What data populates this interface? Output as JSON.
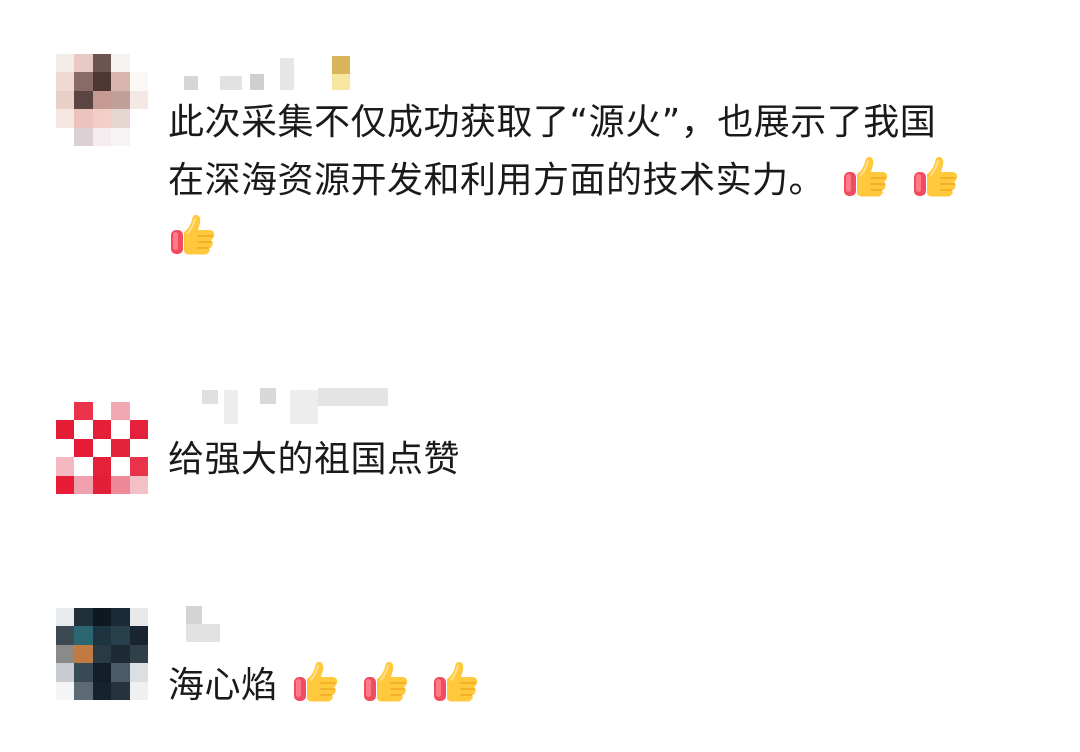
{
  "comments": [
    {
      "lines": [
        "此次采集不仅成功获取了“源火”，也展示了我国",
        "在深海资源开发和利用方面的技术实力。"
      ],
      "emojis": [
        "thumbs-up",
        "thumbs-up",
        "thumbs-up"
      ]
    },
    {
      "lines": [
        "给强大的祖国点赞"
      ],
      "emojis": []
    },
    {
      "lines": [
        "海心焰"
      ],
      "emojis": [
        "thumbs-up",
        "thumbs-up",
        "thumbs-up"
      ]
    }
  ],
  "colors": {
    "text": "#1a1a1a",
    "thumb_yellow": "#ffc83d",
    "thumb_cuff": "#f25060"
  }
}
